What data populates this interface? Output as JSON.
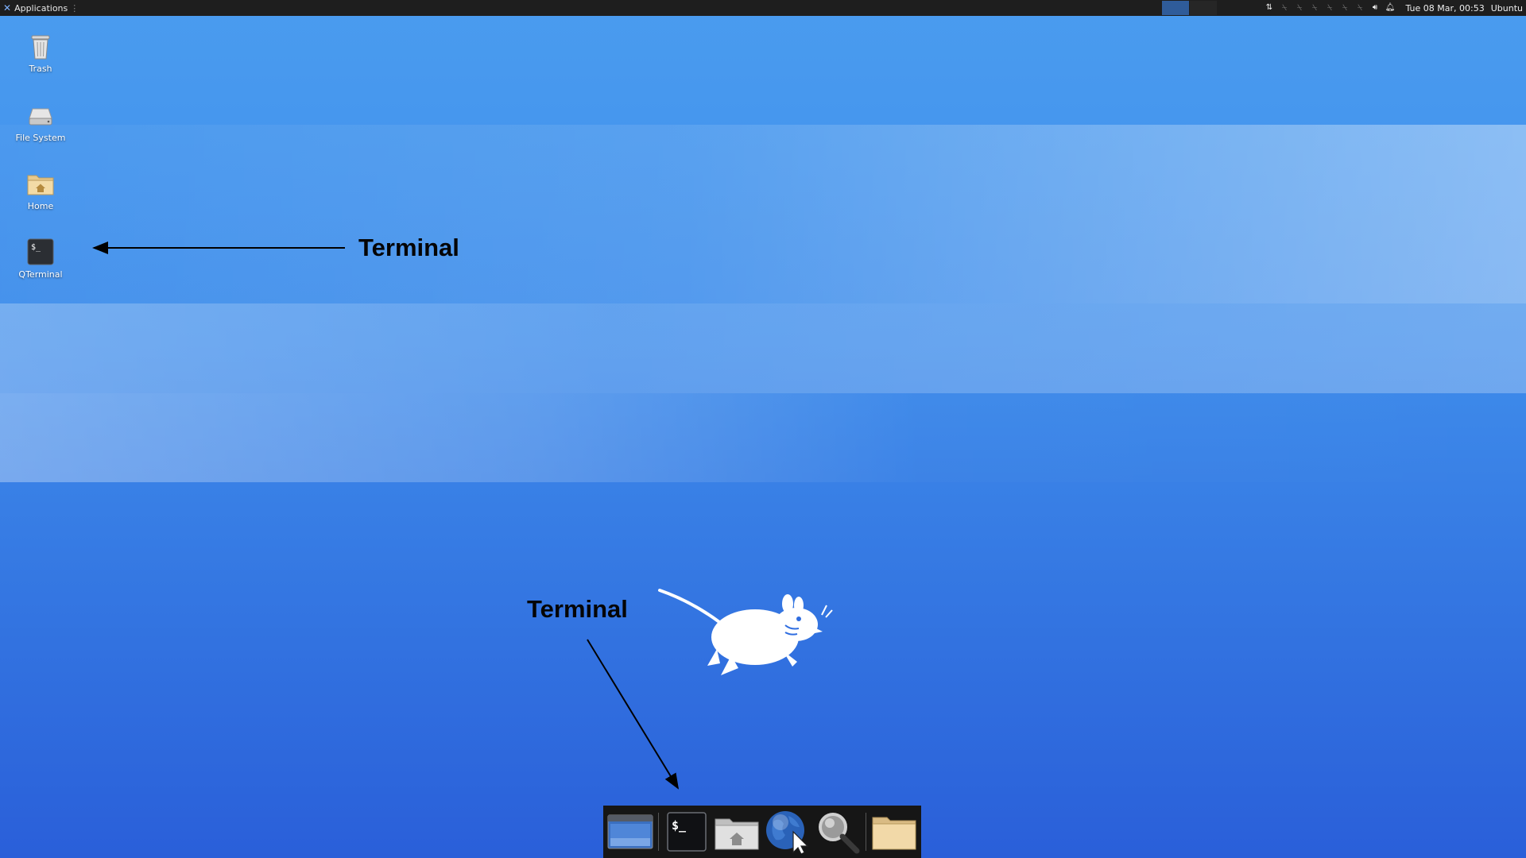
{
  "top_panel": {
    "applications_label": "Applications",
    "separator": "⋮",
    "clock": "Tue 08 Mar, 00:53",
    "user": "Ubuntu"
  },
  "desktop_icons": [
    {
      "label": "Trash",
      "icon": "trash-icon"
    },
    {
      "label": "File System",
      "icon": "drive-icon"
    },
    {
      "label": "Home",
      "icon": "home-folder-icon"
    },
    {
      "label": "QTerminal",
      "icon": "terminal-icon"
    }
  ],
  "annotations": {
    "top_label": "Terminal",
    "bottom_label": "Terminal"
  },
  "dock": {
    "items": [
      {
        "icon": "show-desktop-icon"
      },
      {
        "icon": "terminal-icon",
        "glyph": "$_"
      },
      {
        "icon": "home-folder-icon"
      },
      {
        "icon": "web-browser-icon"
      },
      {
        "icon": "search-icon"
      },
      {
        "icon": "folder-icon"
      }
    ]
  },
  "colors": {
    "panel_bg": "#1e1e1e",
    "wallpaper_top": "#4a9cef",
    "wallpaper_bottom": "#2a5fd9",
    "dock_bg": "#161616"
  }
}
